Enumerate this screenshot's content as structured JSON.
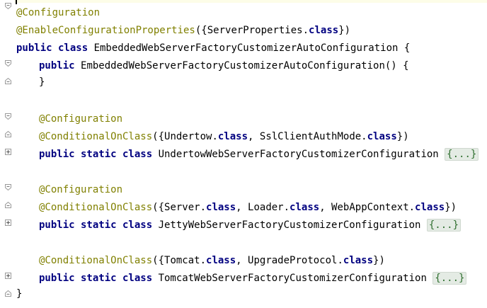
{
  "editor": {
    "lines": [
      {
        "parts": [
          {
            "t": "@Configuration",
            "c": "ann"
          }
        ]
      },
      {
        "parts": [
          {
            "t": "@EnableConfigurationProperties",
            "c": "ann"
          },
          {
            "t": "({ServerProperties."
          },
          {
            "t": "class",
            "c": "kw"
          },
          {
            "t": "})"
          }
        ]
      },
      {
        "parts": [
          {
            "t": "public class ",
            "c": "kw"
          },
          {
            "t": "EmbeddedWebServerFactoryCustomizerAutoConfiguration {"
          }
        ]
      },
      {
        "parts": [
          {
            "t": "public ",
            "c": "kw"
          },
          {
            "t": "EmbeddedWebServerFactoryCustomizerAutoConfiguration() {"
          }
        ]
      },
      {
        "parts": [
          {
            "t": "}"
          }
        ]
      },
      {
        "parts": [
          {
            "t": "@Configuration",
            "c": "ann"
          }
        ]
      },
      {
        "parts": [
          {
            "t": "@ConditionalOnClass",
            "c": "ann"
          },
          {
            "t": "({Undertow."
          },
          {
            "t": "class",
            "c": "kw"
          },
          {
            "t": ", SslClientAuthMode."
          },
          {
            "t": "class",
            "c": "kw"
          },
          {
            "t": "})"
          }
        ]
      },
      {
        "parts": [
          {
            "t": "public static class ",
            "c": "kw"
          },
          {
            "t": "UndertowWebServerFactoryCustomizerConfiguration "
          }
        ],
        "fold": "{...}"
      },
      {
        "parts": [
          {
            "t": "@Configuration",
            "c": "ann"
          }
        ]
      },
      {
        "parts": [
          {
            "t": "@ConditionalOnClass",
            "c": "ann"
          },
          {
            "t": "({Server."
          },
          {
            "t": "class",
            "c": "kw"
          },
          {
            "t": ", Loader."
          },
          {
            "t": "class",
            "c": "kw"
          },
          {
            "t": ", WebAppContext."
          },
          {
            "t": "class",
            "c": "kw"
          },
          {
            "t": "})"
          }
        ]
      },
      {
        "parts": [
          {
            "t": "public static class ",
            "c": "kw"
          },
          {
            "t": "JettyWebServerFactoryCustomizerConfiguration "
          }
        ],
        "fold": "{...}"
      },
      {
        "parts": [
          {
            "t": "@ConditionalOnClass",
            "c": "ann"
          },
          {
            "t": "({Tomcat."
          },
          {
            "t": "class",
            "c": "kw"
          },
          {
            "t": ", UpgradeProtocol."
          },
          {
            "t": "class",
            "c": "kw"
          },
          {
            "t": "})"
          }
        ]
      },
      {
        "parts": [
          {
            "t": "public static class ",
            "c": "kw"
          },
          {
            "t": "TomcatWebServerFactoryCustomizerConfiguration "
          }
        ],
        "fold": "{...}"
      },
      {
        "parts": [
          {
            "t": "}"
          }
        ]
      }
    ]
  },
  "colors": {
    "keyword": "#000080",
    "annotation": "#808000",
    "fold_bg": "#e4ebe4"
  }
}
